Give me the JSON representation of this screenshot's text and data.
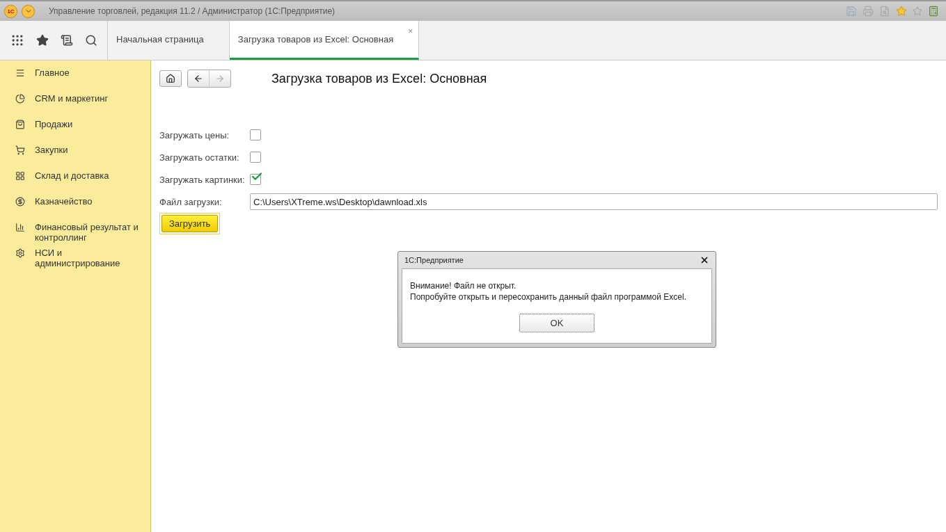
{
  "window": {
    "logo": "1С",
    "title": "Управление торговлей, редакция 11.2 / Администратор  (1С:Предприятие)"
  },
  "tabs": [
    {
      "label": "Начальная страница",
      "selected": false,
      "closable": false
    },
    {
      "label": "Загрузка товаров из Excel: Основная",
      "selected": true,
      "closable": true
    }
  ],
  "tab_close": "×",
  "sidebar": {
    "items": [
      {
        "label": "Главное"
      },
      {
        "label": "CRM и маркетинг"
      },
      {
        "label": "Продажи"
      },
      {
        "label": "Закупки"
      },
      {
        "label": "Склад и доставка"
      },
      {
        "label": "Казначейство"
      },
      {
        "label": "Финансовый результат и контроллинг"
      },
      {
        "label": "НСИ и администрирование"
      }
    ]
  },
  "form": {
    "title": "Загрузка товаров из Excel: Основная",
    "nav": {
      "forward_disabled": true
    },
    "checkboxes": [
      {
        "label": "Загружать цены:",
        "checked": false
      },
      {
        "label": "Загружать остатки:",
        "checked": false
      },
      {
        "label": "Загружать картинки:",
        "checked": true
      }
    ],
    "file": {
      "label": "Файл загрузки:",
      "value": "C:\\Users\\XTreme.ws\\Desktop\\dawnload.xls"
    },
    "submit": "Загрузить"
  },
  "dialog": {
    "title": "1С:Предприятие",
    "lines": [
      "Внимание! Файл не открыт.",
      "Попробуйте открыть и пересохранить данный файл программой Excel."
    ],
    "button": "OK"
  }
}
